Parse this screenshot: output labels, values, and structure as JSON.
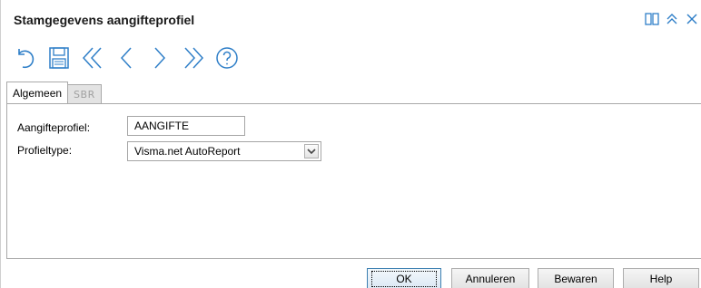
{
  "window": {
    "title": "Stamgegevens aangifteprofiel"
  },
  "title_icons": [
    {
      "name": "panels-icon"
    },
    {
      "name": "collapse-up-icon"
    },
    {
      "name": "close-icon"
    }
  ],
  "toolbar": {
    "icons": [
      "undo-icon",
      "save-icon",
      "first-record-icon",
      "previous-record-icon",
      "next-record-icon",
      "last-record-icon",
      "help-icon"
    ],
    "accent": "#2f7fc8"
  },
  "tabs": [
    {
      "label": "Algemeen",
      "active": true
    },
    {
      "label": "SBR",
      "active": false
    }
  ],
  "form": {
    "profile_label": "Aangifteprofiel:",
    "profile_value": "AANGIFTE",
    "type_label": "Profieltype:",
    "type_value": "Visma.net AutoReport"
  },
  "buttons": {
    "ok": "OK",
    "cancel": "Annuleren",
    "save": "Bewaren",
    "help": "Help"
  }
}
